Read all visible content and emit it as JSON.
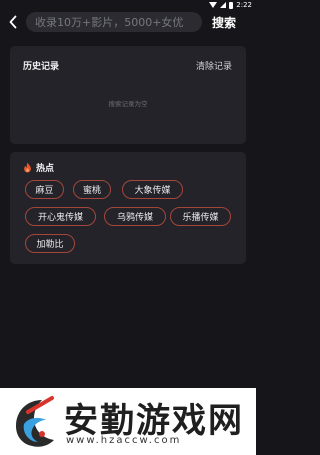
{
  "status": {
    "time": "2:22"
  },
  "search": {
    "placeholder": "收录10万+影片，5000+女优",
    "value": "",
    "button_label": "搜索"
  },
  "history": {
    "title": "历史记录",
    "clear_label": "清除记录",
    "empty_text": "搜索记录为空"
  },
  "hot": {
    "title": "热点",
    "tags": [
      "麻豆",
      "蜜桃",
      "大象传媒",
      "开心鬼传媒",
      "乌鸦传媒",
      "乐播传媒",
      "加勒比"
    ]
  },
  "watermark": {
    "title": "安勤游戏网",
    "url": "www.hzaccw.com"
  },
  "colors": {
    "background": "#16161a",
    "card": "#232329",
    "tag_border": "#a4473b",
    "accent_flame": "#e8562a"
  }
}
